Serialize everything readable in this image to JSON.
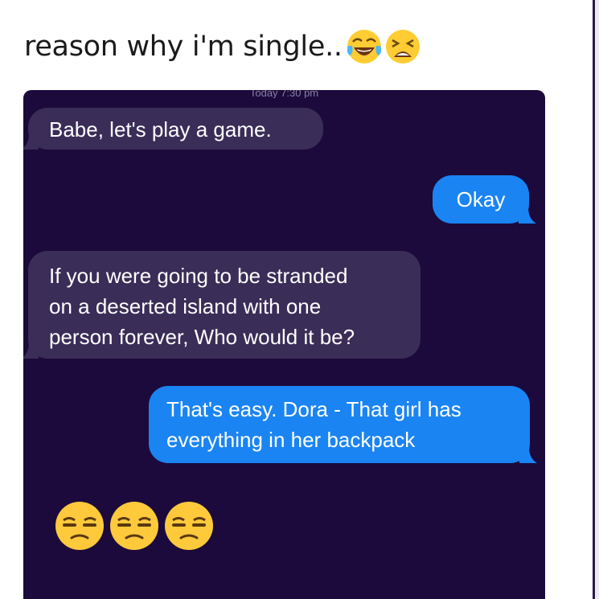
{
  "post": {
    "caption": "reason why i'm single..",
    "caption_emojis": [
      "face-with-tears-of-joy-icon",
      "tired-face-icon"
    ]
  },
  "chat": {
    "timestamp": "Today 7:30 pm",
    "messages": [
      {
        "direction": "incoming",
        "lines": [
          "Babe, let's play a game."
        ]
      },
      {
        "direction": "outgoing",
        "lines": [
          "Okay"
        ]
      },
      {
        "direction": "incoming",
        "lines": [
          "If you were going to be stranded",
          "on a deserted island with one",
          "person forever, Who would it be?"
        ]
      },
      {
        "direction": "outgoing",
        "lines": [
          "That's easy. Dora - That girl has",
          "everything in her backpack"
        ]
      }
    ],
    "reaction_emojis": [
      "unamused-face-icon",
      "unamused-face-icon",
      "unamused-face-icon"
    ]
  },
  "colors": {
    "chat_background": "#1b0a3b",
    "incoming_bubble": "#3a2d57",
    "outgoing_bubble": "#1a84f3"
  }
}
